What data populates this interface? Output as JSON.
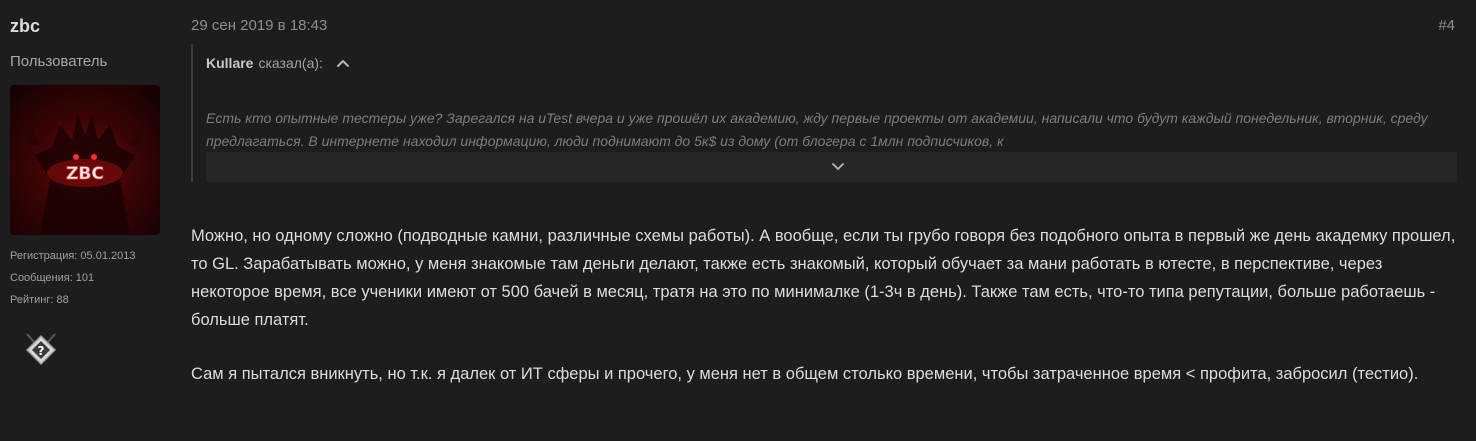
{
  "user": {
    "name": "zbc",
    "title": "Пользователь",
    "avatar_text": "ZBC",
    "registration": "Регистрация: 05.01.2013",
    "messages": "Сообщения: 101",
    "rating": "Рейтинг: 88",
    "badge_symbol": "?"
  },
  "post": {
    "date": "29 сен 2019 в 18:43",
    "number": "#4"
  },
  "quote": {
    "author": "Kullare",
    "said": "сказал(а):",
    "text": "Есть кто опытные тестеры уже? Зарегался на uTest вчера и уже прошёл их академию, жду первые проекты от академии, написали что будут каждый понедельник, вторник, среду предлагаться. В интернете находил информацию, люди поднимают до 5к$ из дому (от блогера с 1млн подписчиков, к"
  },
  "message": {
    "paragraph_1": "Можно, но одному сложно (подводные камни, различные схемы работы). А вообще, если ты грубо говоря без подобного опыта в первый же день академку прошел, то GL. Зарабатывать можно, у меня знакомые там деньги делают, также есть знакомый, который обучает за мани работать в ютесте, в перспективе, через некоторое время, все ученики имеют от 500 бачей в месяц, тратя на это по минималке (1-3ч в день). Также там есть, что-то типа репутации, больше работаешь - больше платят.",
    "paragraph_2": "Сам я пытался вникнуть, но т.к. я далек от ИТ сферы и прочего, у меня нет в общем столько времени, чтобы затраченное время < профита, забросил (тестио)."
  },
  "icons": {
    "collapse": "chevron-up-icon",
    "expand": "chevron-down-icon",
    "badge": "rank-badge-icon"
  },
  "colors": {
    "background": "#1d1d1f",
    "quote_fade": "#262628",
    "text": "#dcdcde",
    "muted": "#8e8e91"
  }
}
